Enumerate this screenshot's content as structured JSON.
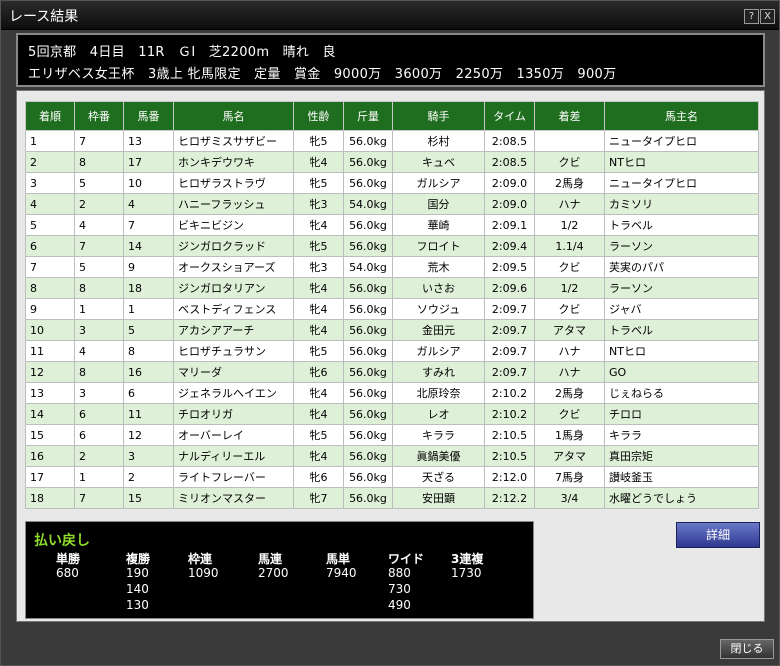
{
  "window": {
    "title": "レース結果",
    "help": "?",
    "close": "X"
  },
  "header": {
    "line1": "5回京都　4日目　11R　ＧⅠ　芝2200m　晴れ　良",
    "line2": "エリザベス女王杯　3歳上 牝馬限定　定量　賞金　9000万　3600万　2250万　1350万　900万"
  },
  "table": {
    "columns": [
      "着順",
      "枠番",
      "馬番",
      "馬名",
      "性齢",
      "斤量",
      "騎手",
      "タイム",
      "着差",
      "馬主名"
    ],
    "rows": [
      [
        "1",
        "7",
        "13",
        "ヒロザミスサザビー",
        "牝5",
        "56.0kg",
        "杉村",
        "2:08.5",
        "",
        "ニュータイプヒロ"
      ],
      [
        "2",
        "8",
        "17",
        "ホンキデウワキ",
        "牝4",
        "56.0kg",
        "キュベ",
        "2:08.5",
        "クビ",
        "NTヒロ"
      ],
      [
        "3",
        "5",
        "10",
        "ヒロザラストラヴ",
        "牝5",
        "56.0kg",
        "ガルシア",
        "2:09.0",
        "2馬身",
        "ニュータイプヒロ"
      ],
      [
        "4",
        "2",
        "4",
        "ハニーフラッシュ",
        "牝3",
        "54.0kg",
        "国分",
        "2:09.0",
        "ハナ",
        "カミソリ"
      ],
      [
        "5",
        "4",
        "7",
        "ビキニビジン",
        "牝4",
        "56.0kg",
        "華崎",
        "2:09.1",
        "1/2",
        "トラベル"
      ],
      [
        "6",
        "7",
        "14",
        "ジンガロクラッド",
        "牝5",
        "56.0kg",
        "フロイト",
        "2:09.4",
        "1.1/4",
        "ラーソン"
      ],
      [
        "7",
        "5",
        "9",
        "オークスショアーズ",
        "牝3",
        "54.0kg",
        "荒木",
        "2:09.5",
        "クビ",
        "芙実のパパ"
      ],
      [
        "8",
        "8",
        "18",
        "ジンガロタリアン",
        "牝4",
        "56.0kg",
        "いさお",
        "2:09.6",
        "1/2",
        "ラーソン"
      ],
      [
        "9",
        "1",
        "1",
        "ベストディフェンス",
        "牝4",
        "56.0kg",
        "ソウジュ",
        "2:09.7",
        "クビ",
        "ジャバ"
      ],
      [
        "10",
        "3",
        "5",
        "アカシアアーチ",
        "牝4",
        "56.0kg",
        "金田元",
        "2:09.7",
        "アタマ",
        "トラベル"
      ],
      [
        "11",
        "4",
        "8",
        "ヒロザチュラサン",
        "牝5",
        "56.0kg",
        "ガルシア",
        "2:09.7",
        "ハナ",
        "NTヒロ"
      ],
      [
        "12",
        "8",
        "16",
        "マリーダ",
        "牝6",
        "56.0kg",
        "すみれ",
        "2:09.7",
        "ハナ",
        "GO"
      ],
      [
        "13",
        "3",
        "6",
        "ジェネラルヘイエン",
        "牝4",
        "56.0kg",
        "北原玲奈",
        "2:10.2",
        "2馬身",
        "じぇねらる"
      ],
      [
        "14",
        "6",
        "11",
        "チロオリガ",
        "牝4",
        "56.0kg",
        "レオ",
        "2:10.2",
        "クビ",
        "チロロ"
      ],
      [
        "15",
        "6",
        "12",
        "オーバーレイ",
        "牝5",
        "56.0kg",
        "キララ",
        "2:10.5",
        "1馬身",
        "キララ"
      ],
      [
        "16",
        "2",
        "3",
        "ナルディリーエル",
        "牝4",
        "56.0kg",
        "眞鍋美優",
        "2:10.5",
        "アタマ",
        "真田宗矩"
      ],
      [
        "17",
        "1",
        "2",
        "ライトフレーバー",
        "牝6",
        "56.0kg",
        "天ざる",
        "2:12.0",
        "7馬身",
        "讃岐釜玉"
      ],
      [
        "18",
        "7",
        "15",
        "ミリオンマスター",
        "牝7",
        "56.0kg",
        "安田顕",
        "2:12.2",
        "3/4",
        "水曜どうでしょう"
      ]
    ]
  },
  "payout": {
    "title": "払い戻し",
    "columns": [
      {
        "label": "単勝",
        "values": [
          "680"
        ]
      },
      {
        "label": "複勝",
        "values": [
          "190",
          "140",
          "130"
        ]
      },
      {
        "label": "枠連",
        "values": [
          "1090"
        ]
      },
      {
        "label": "馬連",
        "values": [
          "2700"
        ]
      },
      {
        "label": "馬単",
        "values": [
          "7940"
        ]
      },
      {
        "label": "ワイド",
        "values": [
          "880",
          "730",
          "490"
        ]
      },
      {
        "label": "3連複",
        "values": [
          "1730"
        ]
      }
    ]
  },
  "buttons": {
    "detail": "詳細",
    "close": "閉じる"
  },
  "colors": {
    "header_row": "#1f6e1f",
    "even_row": "#dff0d8",
    "payout_title": "#8fdc2a",
    "detail_button": "#3c48a8"
  }
}
